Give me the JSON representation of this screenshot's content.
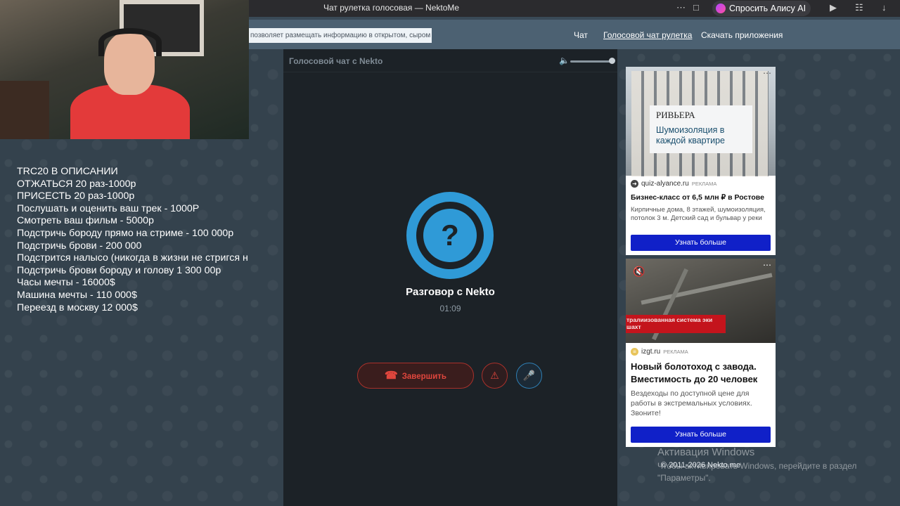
{
  "browser": {
    "tab_title": "Чат рулетка голосовая — NektoMe",
    "more_icon": "⋯",
    "bookmark_icon": "⌑",
    "alice_label": "Спросить Алису AI",
    "icons": [
      "play-icon",
      "translate-icon",
      "download-icon"
    ]
  },
  "site": {
    "notice": "позволяет размещать информацию в открытом, сыром виде!",
    "nav": [
      "Чат",
      "Голосовой чат рулетка",
      "Скачать приложения"
    ],
    "active_nav": "Голосовой чат рулетка"
  },
  "overlay_lines": [
    "TRC20 В ОПИСАНИИ",
    "ОТЖАТЬСЯ 20 раз-1000р",
    "ПРИСЕСТЬ 20 раз-1000р",
    "Послушать и оценить ваш трек - 1000Р",
    "Смотреть ваш фильм - 5000р",
    "Подстричь бороду прямо на стриме - 100 000р",
    "Подстричь брови - 200 000",
    "Подстрится налысо (никогда в жизни не стригся н",
    "Подстричь брови бороду и голову 1 300 00р",
    "Часы мечты - 16000$",
    "Машина мечты - 110 000$",
    "Переезд в москву 12 000$"
  ],
  "panel": {
    "title": "Голосовой чат с Nekto",
    "volume_level": 1.0,
    "avatar_symbol": "?",
    "call_title": "Разговор с Nekto",
    "call_time": "01:09",
    "end_label": "Завершить"
  },
  "ads": [
    {
      "brand": "РИВЬЕРА",
      "slogan": "Шумоизоляция в каждой квартире",
      "source": "quiz-alyance.ru",
      "source_label": "РЕКЛАМА",
      "title": "Бизнес-класс от 6,5 млн ₽ в Ростове",
      "desc": "Кирпичные дома, 8 этажей, шумоизоляция, потолок 3 м. Детский сад и бульвар у реки",
      "button": "Узнать больше"
    },
    {
      "banner": "тралиизованная система эки шахт",
      "source": "izgt.ru",
      "source_label": "РЕКЛАМА",
      "title": "Новый болотоход с завода. Вместимость до 20 человек",
      "desc": "Вездеходы по доступной цене для работы в экстремальных условиях. Звоните!",
      "button": "Узнать больше"
    }
  ],
  "watermark": {
    "title": "Активация Windows",
    "text": "Чтобы активировать Windows, перейдите в раздел \"Параметры\"."
  },
  "copyright": "© 2011-2026 Nekto.me",
  "colors": {
    "accent_blue": "#2f9ad7",
    "danger_red": "#e0463d",
    "ad_button": "#1020c8"
  }
}
